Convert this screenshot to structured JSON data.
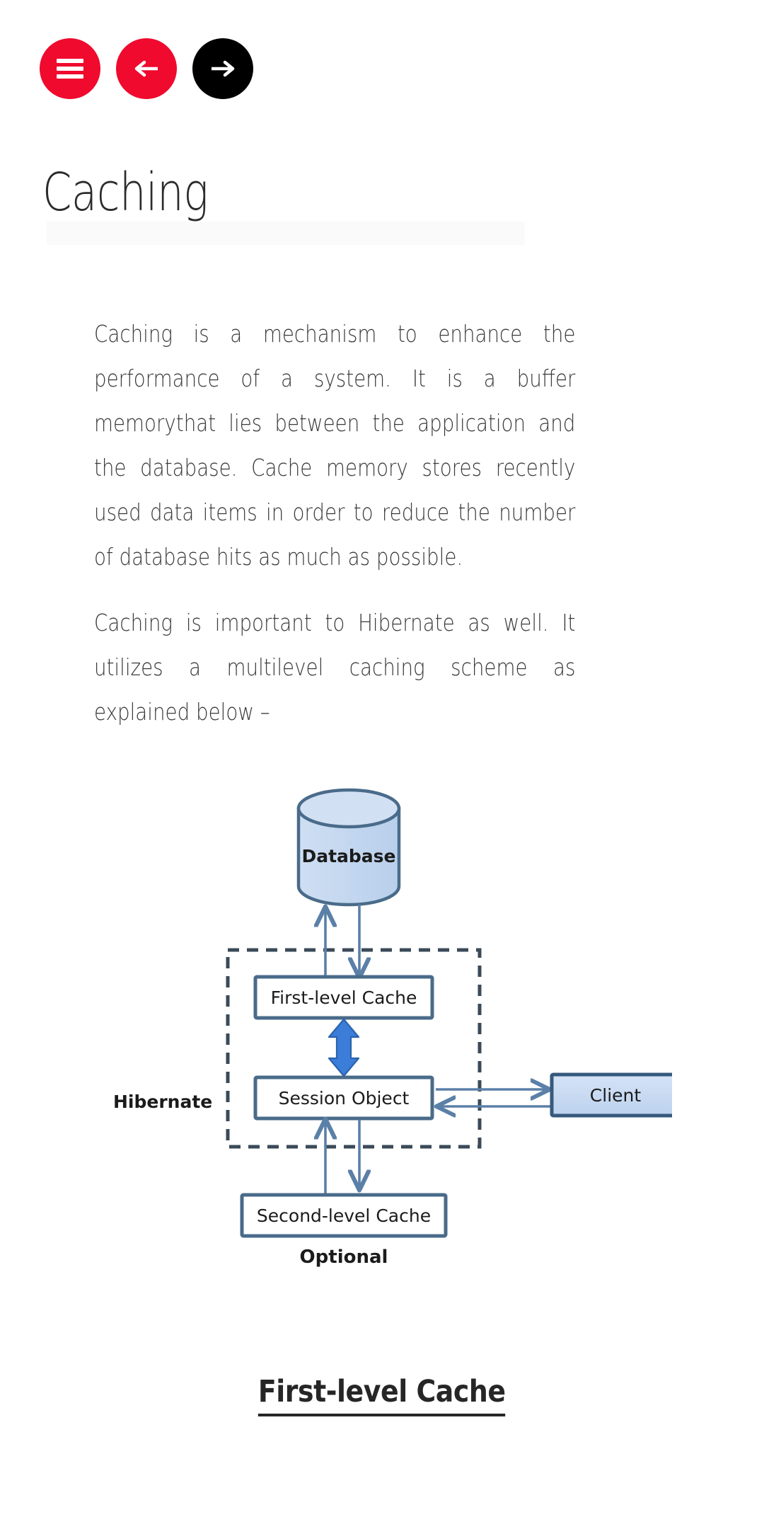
{
  "toolbar": {
    "menu_button": {
      "icon": "hamburger-menu-icon",
      "label": "Menu",
      "color": "#ef0a2e"
    },
    "prev_button": {
      "icon": "arrow-left-icon",
      "label": "Previous",
      "glyph": "←",
      "color": "#ef0a2e"
    },
    "next_button": {
      "icon": "arrow-right-icon",
      "label": "Next",
      "glyph": "→",
      "color": "#000000"
    }
  },
  "header": {
    "title": "Caching"
  },
  "article": {
    "paragraphs": [
      "Caching is a mechanism to enhance the performance of a system. It is a buffer memorythat lies between the application and the database. Cache memory stores recently used data items in order to reduce the number of database hits as much as possible.",
      "Caching is important to Hibernate as well. It utilizes a multilevel caching scheme as explained below –"
    ]
  },
  "diagram": {
    "alt": "Hibernate multilevel caching architecture",
    "nodes": {
      "database": "Database",
      "first_level_cache": "First-level Cache",
      "session_object": "Session Object",
      "second_level_cache": "Second-level Cache",
      "client": "Client"
    },
    "labels": {
      "boundary": "Hibernate",
      "optional": "Optional"
    },
    "colors": {
      "node_fill": "#c6d9f0",
      "node_stroke": "#4a6b8a",
      "box_fill": "#ffffff",
      "arrow": "#5b80a8",
      "accent_arrow": "#3b7dd8",
      "dashed_boundary": "#3a4a58"
    }
  },
  "section": {
    "heading": "First-level Cache"
  }
}
